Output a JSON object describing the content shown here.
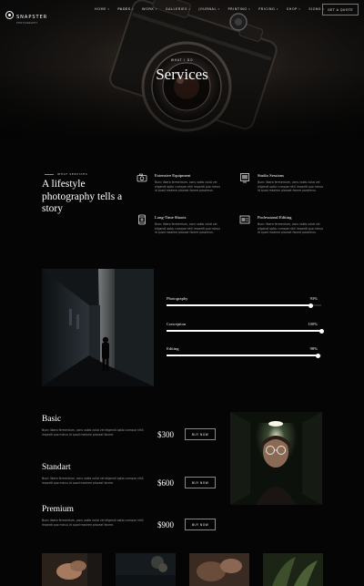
{
  "brand": {
    "name": "SNAPSTER",
    "tagline": "PHOTOGRAPHY"
  },
  "nav": {
    "items": [
      {
        "label": "HOME",
        "caret": true
      },
      {
        "label": "PAGES",
        "caret": true
      },
      {
        "label": "WORK",
        "caret": true
      },
      {
        "label": "GALLERIES",
        "caret": true
      },
      {
        "label": "JOURNAL",
        "caret": true
      },
      {
        "label": "PRINTING",
        "caret": true
      },
      {
        "label": "PRICING",
        "caret": true
      },
      {
        "label": "SHOP",
        "caret": true
      },
      {
        "label": "SIGNS",
        "caret": true
      }
    ],
    "quote_button": "GET A QUOTE"
  },
  "hero": {
    "subtitle": "WHAT I DO",
    "title": "Services"
  },
  "intro": {
    "label": "WHAT SERVICES",
    "heading": "A lifestyle photography tells a story"
  },
  "features": [
    {
      "icon": "camera-icon",
      "title": "Extensive Equipment",
      "text": "Nunc libero fermentum, cons vobis volut vel eligendi optio cumque nihil impedit quo minus id quod maxime placeat facere possimus."
    },
    {
      "icon": "photo-frame-icon",
      "title": "Studio Sessions",
      "text": "Nunc libero fermentum, cons vobis volut vel eligendi optio cumque nihil impedit quo minus id quod maxime placeat facere possimus."
    },
    {
      "icon": "film-roll-icon",
      "title": "Long-Time Shoots",
      "text": "Nunc libero fermentum, cons vobis volut vel eligendi optio cumque nihil impedit quo minus id quod maxime placeat facere possimus."
    },
    {
      "icon": "gallery-icon",
      "title": "Professional Editing",
      "text": "Nunc libero fermentum, cons vobis volut vel eligendi optio cumque nihil impedit quo minus id quod maxime placeat facere possimus."
    }
  ],
  "skills": [
    {
      "label": "Photography",
      "value": "93%",
      "level": 0.93
    },
    {
      "label": "Conception",
      "value": "100%",
      "level": 1.0
    },
    {
      "label": "Editing",
      "value": "98%",
      "level": 0.98
    }
  ],
  "plans": [
    {
      "name": "Basic",
      "desc": "Nunc libero fermentum, cons vobis volut vel eligendi optio cumque nihil impedit quo minus id quod maxime placeat facere.",
      "price": "$300",
      "button": "BUY NOW"
    },
    {
      "name": "Standart",
      "desc": "Nunc libero fermentum, cons vobis volut vel eligendi optio cumque nihil impedit quo minus id quod maxime placeat facere.",
      "price": "$600",
      "button": "BUY NOW"
    },
    {
      "name": "Premium",
      "desc": "Nunc libero fermentum, cons vobis volut vel eligendi optio cumque nihil impedit quo minus id quod maxime placeat facere.",
      "price": "$900",
      "button": "BUY NOW"
    }
  ],
  "colors": {
    "background": "#050505",
    "text": "#ffffff",
    "muted": "#9a9a9a",
    "border": "#888888"
  }
}
